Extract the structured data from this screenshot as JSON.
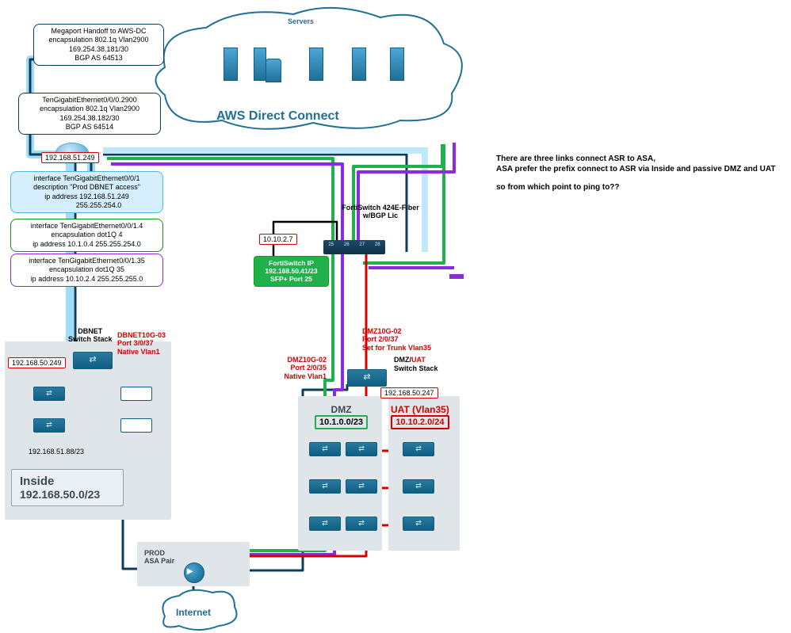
{
  "cloud_aws": {
    "label_top": "Servers",
    "label_main": "AWS Direct Connect"
  },
  "megaport": {
    "l1": "Megaport Handoff to AWS-DC",
    "l2": "encapsulation 802.1q Vlan2900",
    "l3": "169.254.38.181/30",
    "l4": "BGP AS 64513"
  },
  "tge_sub": {
    "l1": "TenGigabitEthernet0/0/0.2900",
    "l2": "encapsulation 802.1q Vlan2900",
    "l3": "169.254.38.182/30",
    "l4": "BGP AS 64514"
  },
  "asr_ip_label": "192.168.51.249",
  "iface_main": {
    "l1": "interface TenGigabitEthernet0/0/1",
    "l2": "description \"Prod DBNET access\"",
    "l3": "ip address 192.168.51.249",
    "l4": "            255.255.254.0"
  },
  "iface_v4": {
    "l1": "interface TenGigabitEthernet0/0/1.4",
    "l2": "encapsulation dot1Q 4",
    "l3": "ip address 10.1.0.4 255.255.254.0"
  },
  "iface_v35": {
    "l1": "interface TenGigabitEthernet0/0/1.35",
    "l2": "encapsulation dot1Q 35",
    "l3": "ip address 10.10.2.4 255.255.255.0"
  },
  "fortiswitch": {
    "title": "FortiSwitch 424E-Fiber\nw/BGP Lic",
    "mgmt": "10.10.2.7",
    "ports": [
      "25",
      "26",
      "27",
      "28"
    ],
    "detail_l1": "FortiSwitch IP",
    "detail_l2": "192.168.50.41/23",
    "detail_l3": "SFP+ Port 25"
  },
  "dbnet": {
    "title": "DBNET\nSwitch Stack",
    "port_label": "DBNET10G-03\nPort 3/0/37\nNative Vlan1",
    "gw": "192.168.50.249",
    "host": "192.168.51.88/23",
    "zone_title": "Inside",
    "zone_cidr": "192.168.50.0/23"
  },
  "dmz": {
    "port35": "DMZ10G-02\nPort 2/0/35\nNative Vlan1",
    "port37": "DMZ10G-02\nPort 2/0/37\nSet for Trunk Vlan35",
    "stack_title_a": "DMZ/",
    "stack_title_b": "UAT",
    "stack_sub": "Switch Stack",
    "gw": "192.168.50.247",
    "zone_dmz_title": "DMZ",
    "zone_dmz_cidr": "10.1.0.0/23",
    "zone_uat_title": "UAT (Vlan35)",
    "zone_uat_cidr": "10.10.2.0/24"
  },
  "asa": {
    "label": "PROD\nASA Pair"
  },
  "internet": "Internet",
  "note": {
    "l1": "There are three links connect ASR to ASA,",
    "l2": "ASA prefer the prefix connect to ASR via Inside and passive DMZ and UAT",
    "l3": "so from which point to ping to??"
  }
}
